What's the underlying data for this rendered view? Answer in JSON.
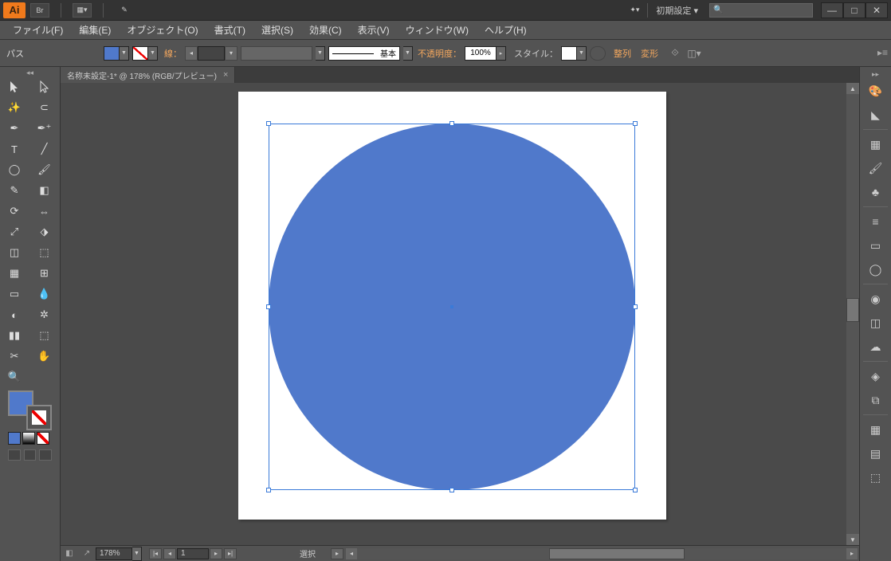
{
  "app": {
    "logo": "Ai",
    "br_label": "Br"
  },
  "preset": "初期設定",
  "window_controls": {
    "min": "—",
    "max": "□",
    "close": "✕"
  },
  "menu": {
    "file": "ファイル(F)",
    "edit": "編集(E)",
    "object": "オブジェクト(O)",
    "type": "書式(T)",
    "select": "選択(S)",
    "effect": "効果(C)",
    "view": "表示(V)",
    "window": "ウィンドウ(W)",
    "help": "ヘルプ(H)"
  },
  "control": {
    "selection_type": "パス",
    "stroke_label": "線：",
    "stroke_weight": "",
    "line_style_label": "基本",
    "opacity_label": "不透明度：",
    "opacity_value": "100%",
    "style_label": "スタイル：",
    "align_link": "整列",
    "transform_link": "変形"
  },
  "document": {
    "tab_title": "名称未設定-1* @ 178% (RGB/プレビュー)",
    "tab_close": "×"
  },
  "status": {
    "zoom": "178%",
    "page": "1",
    "mode_label": "選択"
  },
  "colors": {
    "fill": "#5079cb"
  }
}
